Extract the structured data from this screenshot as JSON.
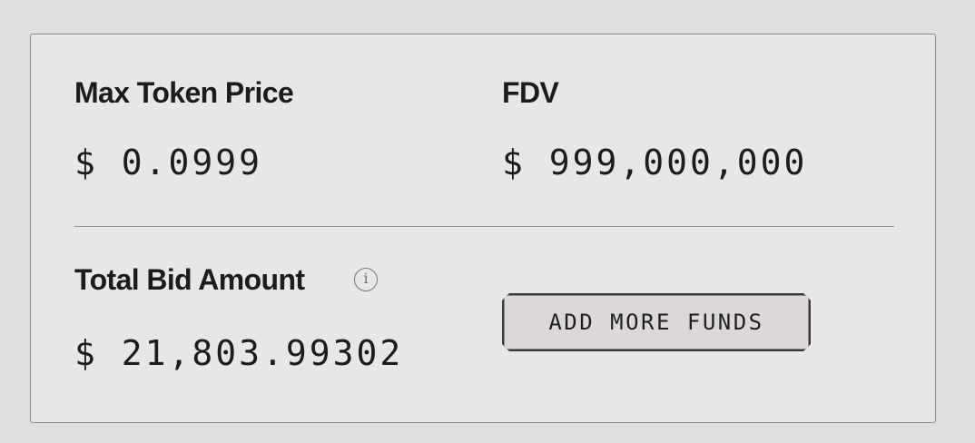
{
  "panel": {
    "max_token_price": {
      "label": "Max Token Price",
      "value": "$ 0.0999"
    },
    "fdv": {
      "label": "FDV",
      "value": "$ 999,000,000"
    },
    "total_bid_amount": {
      "label": "Total Bid Amount",
      "value": "$ 21,803.99302",
      "info_icon": "info-icon",
      "info_glyph": "i"
    },
    "add_funds_button": {
      "label": "ADD MORE FUNDS"
    }
  }
}
